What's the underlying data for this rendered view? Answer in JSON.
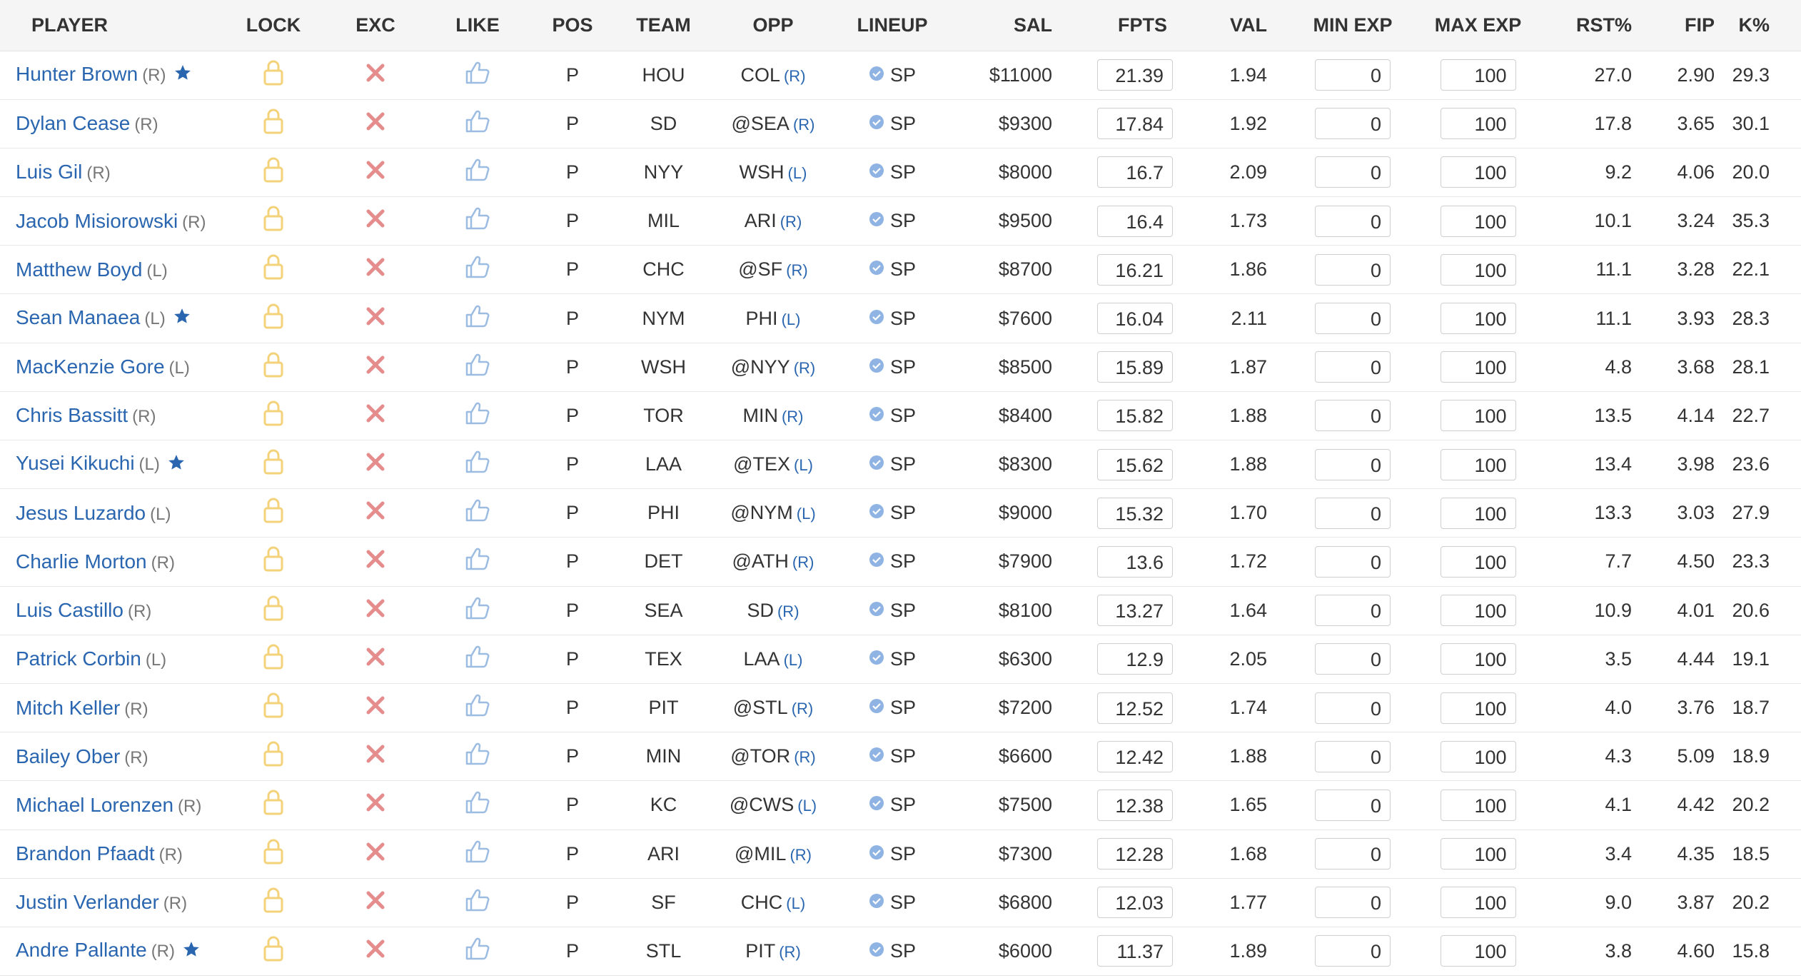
{
  "headers": {
    "player": "PLAYER",
    "lock": "LOCK",
    "exc": "EXC",
    "like": "LIKE",
    "pos": "POS",
    "team": "TEAM",
    "opp": "OPP",
    "lineup": "LINEUP",
    "sal": "SAL",
    "fpts": "FPTS",
    "val": "VAL",
    "min_exp": "MIN EXP",
    "max_exp": "MAX EXP",
    "rst": "RST%",
    "fip": "FIP",
    "k": "K%"
  },
  "colors": {
    "link": "#2a66b0",
    "lock": "#f3d27a",
    "exclude": "#e58c8c",
    "like": "#9dbce2",
    "lineup_check": "#8fb4e3",
    "star": "#2a66b0"
  },
  "icons": {
    "lock": "lock-icon",
    "exclude": "x-icon",
    "like": "thumbs-up-icon",
    "confirmed": "check-circle-icon",
    "star": "star-icon"
  },
  "rows": [
    {
      "name": "Hunter Brown",
      "hand": "(R)",
      "star": true,
      "pos": "P",
      "team": "HOU",
      "opp": "COL",
      "opp_hand": "(R)",
      "lineup": "SP",
      "sal": "$11000",
      "fpts": "21.39",
      "val": "1.94",
      "min_exp": "0",
      "max_exp": "100",
      "rst": "27.0",
      "fip": "2.90",
      "k": "29.3"
    },
    {
      "name": "Dylan Cease",
      "hand": "(R)",
      "star": false,
      "pos": "P",
      "team": "SD",
      "opp": "@SEA",
      "opp_hand": "(R)",
      "lineup": "SP",
      "sal": "$9300",
      "fpts": "17.84",
      "val": "1.92",
      "min_exp": "0",
      "max_exp": "100",
      "rst": "17.8",
      "fip": "3.65",
      "k": "30.1"
    },
    {
      "name": "Luis Gil",
      "hand": "(R)",
      "star": false,
      "pos": "P",
      "team": "NYY",
      "opp": "WSH",
      "opp_hand": "(L)",
      "lineup": "SP",
      "sal": "$8000",
      "fpts": "16.7",
      "val": "2.09",
      "min_exp": "0",
      "max_exp": "100",
      "rst": "9.2",
      "fip": "4.06",
      "k": "20.0"
    },
    {
      "name": "Jacob Misiorowski",
      "hand": "(R)",
      "star": false,
      "pos": "P",
      "team": "MIL",
      "opp": "ARI",
      "opp_hand": "(R)",
      "lineup": "SP",
      "sal": "$9500",
      "fpts": "16.4",
      "val": "1.73",
      "min_exp": "0",
      "max_exp": "100",
      "rst": "10.1",
      "fip": "3.24",
      "k": "35.3"
    },
    {
      "name": "Matthew Boyd",
      "hand": "(L)",
      "star": false,
      "pos": "P",
      "team": "CHC",
      "opp": "@SF",
      "opp_hand": "(R)",
      "lineup": "SP",
      "sal": "$8700",
      "fpts": "16.21",
      "val": "1.86",
      "min_exp": "0",
      "max_exp": "100",
      "rst": "11.1",
      "fip": "3.28",
      "k": "22.1"
    },
    {
      "name": "Sean Manaea",
      "hand": "(L)",
      "star": true,
      "pos": "P",
      "team": "NYM",
      "opp": "PHI",
      "opp_hand": "(L)",
      "lineup": "SP",
      "sal": "$7600",
      "fpts": "16.04",
      "val": "2.11",
      "min_exp": "0",
      "max_exp": "100",
      "rst": "11.1",
      "fip": "3.93",
      "k": "28.3"
    },
    {
      "name": "MacKenzie Gore",
      "hand": "(L)",
      "star": false,
      "pos": "P",
      "team": "WSH",
      "opp": "@NYY",
      "opp_hand": "(R)",
      "lineup": "SP",
      "sal": "$8500",
      "fpts": "15.89",
      "val": "1.87",
      "min_exp": "0",
      "max_exp": "100",
      "rst": "4.8",
      "fip": "3.68",
      "k": "28.1"
    },
    {
      "name": "Chris Bassitt",
      "hand": "(R)",
      "star": false,
      "pos": "P",
      "team": "TOR",
      "opp": "MIN",
      "opp_hand": "(R)",
      "lineup": "SP",
      "sal": "$8400",
      "fpts": "15.82",
      "val": "1.88",
      "min_exp": "0",
      "max_exp": "100",
      "rst": "13.5",
      "fip": "4.14",
      "k": "22.7"
    },
    {
      "name": "Yusei Kikuchi",
      "hand": "(L)",
      "star": true,
      "pos": "P",
      "team": "LAA",
      "opp": "@TEX",
      "opp_hand": "(L)",
      "lineup": "SP",
      "sal": "$8300",
      "fpts": "15.62",
      "val": "1.88",
      "min_exp": "0",
      "max_exp": "100",
      "rst": "13.4",
      "fip": "3.98",
      "k": "23.6"
    },
    {
      "name": "Jesus Luzardo",
      "hand": "(L)",
      "star": false,
      "pos": "P",
      "team": "PHI",
      "opp": "@NYM",
      "opp_hand": "(L)",
      "lineup": "SP",
      "sal": "$9000",
      "fpts": "15.32",
      "val": "1.70",
      "min_exp": "0",
      "max_exp": "100",
      "rst": "13.3",
      "fip": "3.03",
      "k": "27.9"
    },
    {
      "name": "Charlie Morton",
      "hand": "(R)",
      "star": false,
      "pos": "P",
      "team": "DET",
      "opp": "@ATH",
      "opp_hand": "(R)",
      "lineup": "SP",
      "sal": "$7900",
      "fpts": "13.6",
      "val": "1.72",
      "min_exp": "0",
      "max_exp": "100",
      "rst": "7.7",
      "fip": "4.50",
      "k": "23.3"
    },
    {
      "name": "Luis Castillo",
      "hand": "(R)",
      "star": false,
      "pos": "P",
      "team": "SEA",
      "opp": "SD",
      "opp_hand": "(R)",
      "lineup": "SP",
      "sal": "$8100",
      "fpts": "13.27",
      "val": "1.64",
      "min_exp": "0",
      "max_exp": "100",
      "rst": "10.9",
      "fip": "4.01",
      "k": "20.6"
    },
    {
      "name": "Patrick Corbin",
      "hand": "(L)",
      "star": false,
      "pos": "P",
      "team": "TEX",
      "opp": "LAA",
      "opp_hand": "(L)",
      "lineup": "SP",
      "sal": "$6300",
      "fpts": "12.9",
      "val": "2.05",
      "min_exp": "0",
      "max_exp": "100",
      "rst": "3.5",
      "fip": "4.44",
      "k": "19.1"
    },
    {
      "name": "Mitch Keller",
      "hand": "(R)",
      "star": false,
      "pos": "P",
      "team": "PIT",
      "opp": "@STL",
      "opp_hand": "(R)",
      "lineup": "SP",
      "sal": "$7200",
      "fpts": "12.52",
      "val": "1.74",
      "min_exp": "0",
      "max_exp": "100",
      "rst": "4.0",
      "fip": "3.76",
      "k": "18.7"
    },
    {
      "name": "Bailey Ober",
      "hand": "(R)",
      "star": false,
      "pos": "P",
      "team": "MIN",
      "opp": "@TOR",
      "opp_hand": "(R)",
      "lineup": "SP",
      "sal": "$6600",
      "fpts": "12.42",
      "val": "1.88",
      "min_exp": "0",
      "max_exp": "100",
      "rst": "4.3",
      "fip": "5.09",
      "k": "18.9"
    },
    {
      "name": "Michael Lorenzen",
      "hand": "(R)",
      "star": false,
      "pos": "P",
      "team": "KC",
      "opp": "@CWS",
      "opp_hand": "(L)",
      "lineup": "SP",
      "sal": "$7500",
      "fpts": "12.38",
      "val": "1.65",
      "min_exp": "0",
      "max_exp": "100",
      "rst": "4.1",
      "fip": "4.42",
      "k": "20.2"
    },
    {
      "name": "Brandon Pfaadt",
      "hand": "(R)",
      "star": false,
      "pos": "P",
      "team": "ARI",
      "opp": "@MIL",
      "opp_hand": "(R)",
      "lineup": "SP",
      "sal": "$7300",
      "fpts": "12.28",
      "val": "1.68",
      "min_exp": "0",
      "max_exp": "100",
      "rst": "3.4",
      "fip": "4.35",
      "k": "18.5"
    },
    {
      "name": "Justin Verlander",
      "hand": "(R)",
      "star": false,
      "pos": "P",
      "team": "SF",
      "opp": "CHC",
      "opp_hand": "(L)",
      "lineup": "SP",
      "sal": "$6800",
      "fpts": "12.03",
      "val": "1.77",
      "min_exp": "0",
      "max_exp": "100",
      "rst": "9.0",
      "fip": "3.87",
      "k": "20.2"
    },
    {
      "name": "Andre Pallante",
      "hand": "(R)",
      "star": true,
      "pos": "P",
      "team": "STL",
      "opp": "PIT",
      "opp_hand": "(R)",
      "lineup": "SP",
      "sal": "$6000",
      "fpts": "11.37",
      "val": "1.89",
      "min_exp": "0",
      "max_exp": "100",
      "rst": "3.8",
      "fip": "4.60",
      "k": "15.8"
    }
  ]
}
